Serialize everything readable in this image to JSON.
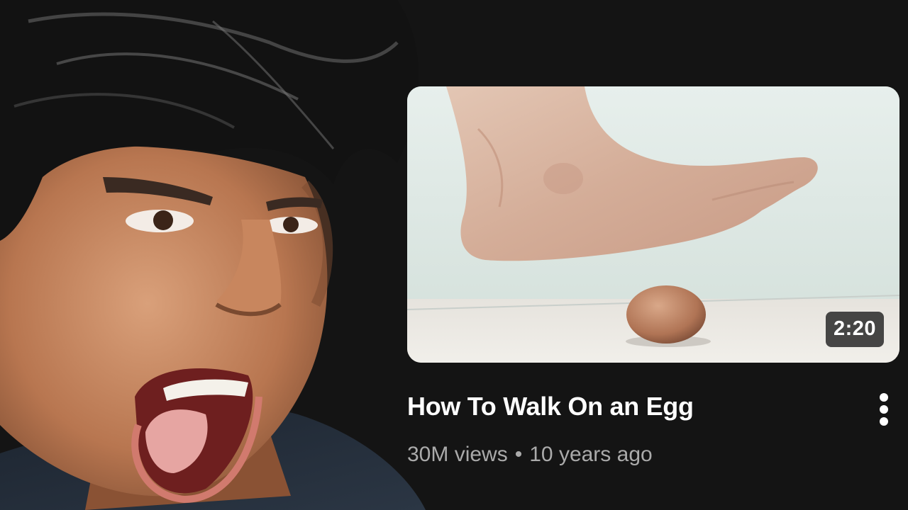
{
  "video": {
    "duration": "2:20",
    "title": "How To Walk On an Egg",
    "views": "30M views",
    "separator": "•",
    "age": "10 years ago"
  },
  "icons": {
    "more": "more-vert-icon"
  },
  "colors": {
    "background": "#141414",
    "title": "#ffffff",
    "meta": "#aaaaaa",
    "badge_bg": "#282828"
  }
}
